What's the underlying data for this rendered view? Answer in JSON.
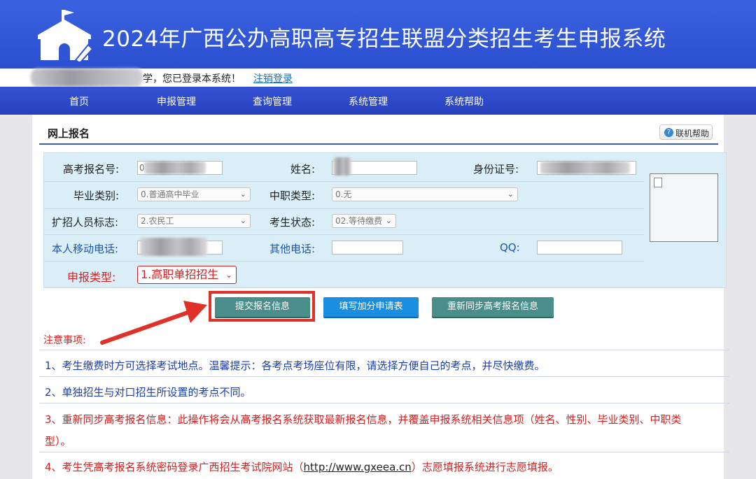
{
  "header": {
    "title": "2024年广西公办高职高专招生联盟分类招生考生申报系统",
    "logo_icon": "school-house-pencil-icon"
  },
  "login_bar": {
    "message": "学，您已登录本系统！",
    "logout_label": "注销登录"
  },
  "nav": {
    "items": [
      {
        "label": "首页"
      },
      {
        "label": "申报管理"
      },
      {
        "label": "查询管理"
      },
      {
        "label": "系统管理"
      },
      {
        "label": "系统帮助"
      }
    ]
  },
  "section": {
    "title": "网上报名",
    "help_label": "联机帮助"
  },
  "form": {
    "exam_no_label": "高考报名号:",
    "exam_no_value": "0",
    "name_label": "姓名:",
    "id_label": "身份证号:",
    "grad_type_label": "毕业类别:",
    "grad_type_value": "0.普通高中毕业",
    "vocational_type_label": "中职类型:",
    "vocational_type_value": "0.无",
    "expansion_label": "扩招人员标志:",
    "expansion_value": "2.农民工",
    "status_label": "考生状态:",
    "status_value": "02.等待缴费",
    "mobile_label": "本人移动电话:",
    "other_phone_label": "其他电话:",
    "qq_label": "QQ:",
    "apply_type_label": "申报类型:",
    "apply_type_value": "1.高职单招招生"
  },
  "buttons": {
    "submit": "提交报名信息",
    "bonus": "填写加分申请表",
    "resync": "重新同步高考报名信息"
  },
  "notes": {
    "title": "注意事项:",
    "n1": "1、考生缴费时方可选择考试地点。温馨提示：各考点考场座位有限，请选择方便自己的考点，并尽快缴费。",
    "n2": "2、单独招生与对口招生所设置的考点不同。",
    "n3a": "3、重新同步高考报名信息：此操作将会从高考报名系统获取最新报名信息，并覆盖申报系统相关信息项（姓名、性别、毕业类别、中职类",
    "n3b": "型）。",
    "n4a": "4、考生凭高考报名系统密码登录广西招生考试院网站（",
    "n4url": "http://www.gxeea.cn",
    "n4b": "）志愿填报系统进行志愿填报。"
  },
  "colors": {
    "header_blue": "#2f55d4",
    "nav_blue": "#2c48c9",
    "form_bg": "#daeef8",
    "accent_red": "#e03128",
    "teal_button": "#4a8e8b",
    "blue_button": "#1c8ee0"
  }
}
